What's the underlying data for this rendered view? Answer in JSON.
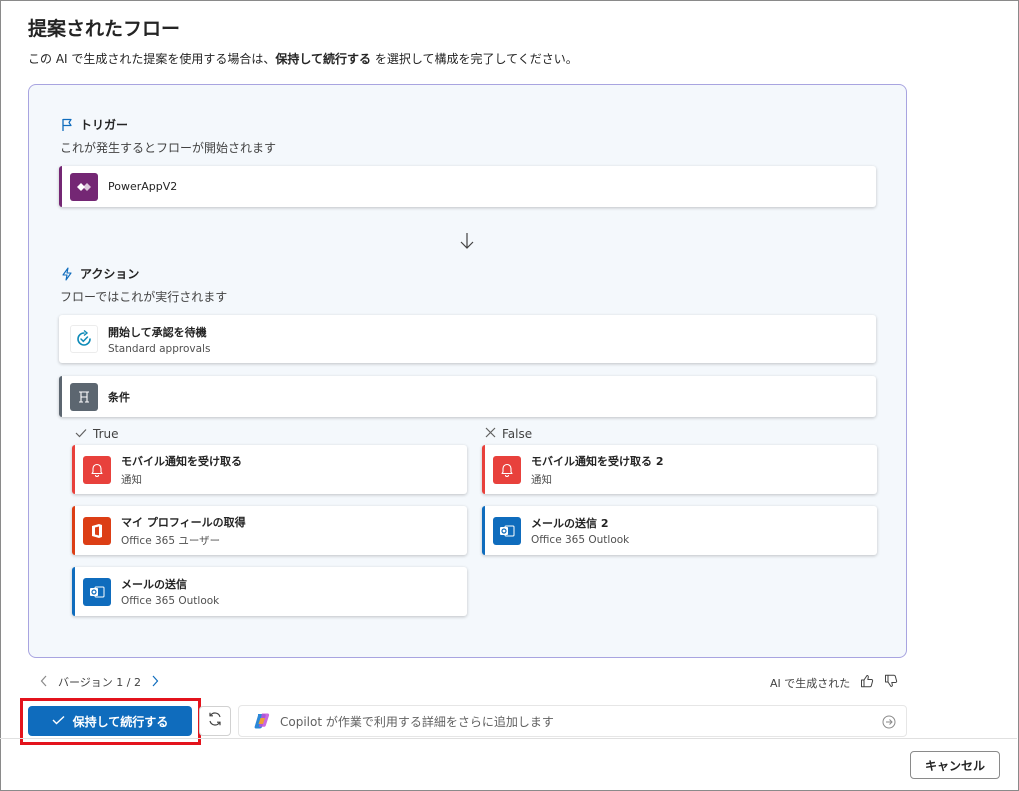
{
  "header": {
    "title": "提案されたフロー",
    "subtitle_pre": "この AI で生成された提案を使用する場合は、",
    "subtitle_bold": "保持して続行する",
    "subtitle_post": " を選択して構成を完了してください。"
  },
  "trigger": {
    "heading": "トリガー",
    "description": "これが発生するとフローが開始されます",
    "card": {
      "name": "PowerAppV2",
      "color": "#742774",
      "icon": "powerapps-icon"
    }
  },
  "actions": {
    "heading": "アクション",
    "description": "フローではこれが実行されます",
    "approval": {
      "name": "開始して承認を待機",
      "sub": "Standard approvals",
      "icon": "approval-icon"
    },
    "condition": {
      "name": "条件",
      "color": "#5c6670",
      "icon": "condition-icon"
    }
  },
  "branches": {
    "true_label": "True",
    "false_label": "False",
    "true_items": [
      {
        "name": "モバイル通知を受け取る",
        "sub": "通知",
        "color": "#e8413c",
        "icon": "bell-icon"
      },
      {
        "name": "マイ プロフィールの取得",
        "sub": "Office 365 ユーザー",
        "color": "#dc3e15",
        "icon": "office-icon"
      },
      {
        "name": "メールの送信",
        "sub": "Office 365 Outlook",
        "color": "#0f6cbd",
        "icon": "outlook-icon"
      }
    ],
    "false_items": [
      {
        "name": "モバイル通知を受け取る 2",
        "sub": "通知",
        "color": "#e8413c",
        "icon": "bell-icon"
      },
      {
        "name": "メールの送信 2",
        "sub": "Office 365 Outlook",
        "color": "#0f6cbd",
        "icon": "outlook-icon"
      }
    ]
  },
  "version": {
    "label": "バージョン 1 / 2"
  },
  "feedback": {
    "label": "AI で生成された"
  },
  "buttons": {
    "keep_continue": "保持して続行する",
    "cancel": "キャンセル"
  },
  "prompt": {
    "placeholder": "Copilot が作業で利用する詳細をさらに追加します"
  },
  "colors": {
    "accent": "#0f6cbd",
    "highlight": "#e3131c"
  }
}
